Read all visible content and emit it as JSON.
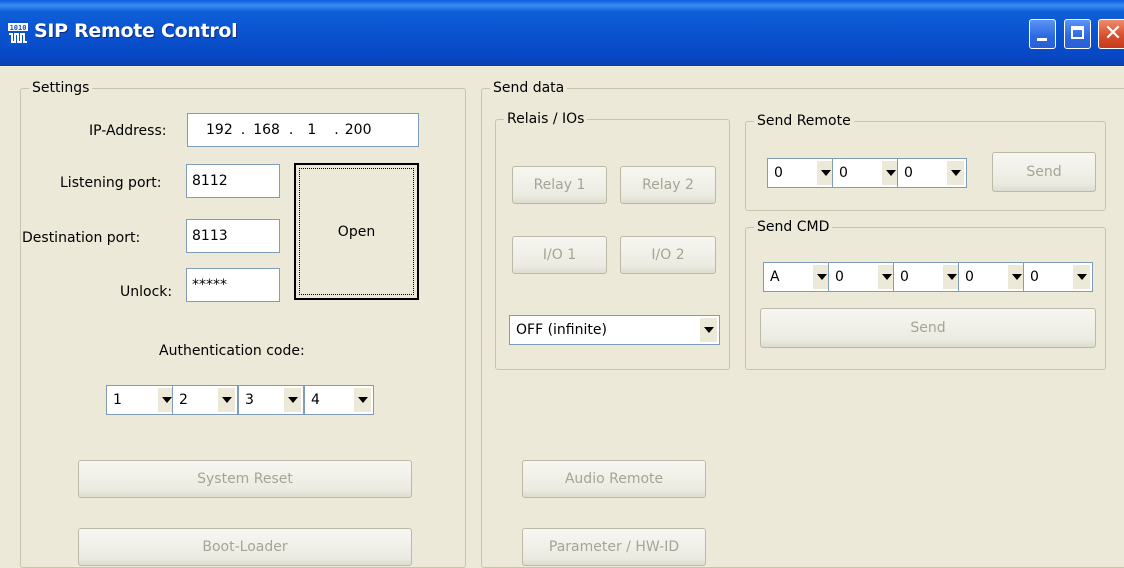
{
  "window": {
    "title": "SIP Remote Control"
  },
  "settings": {
    "group_label": "Settings",
    "ip_label": "IP-Address:",
    "ip": [
      "192",
      "168",
      "1",
      "200"
    ],
    "listen_label": "Listening port:",
    "listen_value": "8112",
    "dest_label": "Destination port:",
    "dest_value": "8113",
    "unlock_label": "Unlock:",
    "unlock_value": "*****",
    "open_label": "Open",
    "auth_label": "Authentication code:",
    "auth_codes": [
      "1",
      "2",
      "3",
      "4"
    ],
    "system_reset_label": "System Reset",
    "boot_loader_label": "Boot-Loader"
  },
  "send_data": {
    "group_label": "Send data",
    "relais": {
      "group_label": "Relais / IOs",
      "relay1_label": "Relay 1",
      "relay2_label": "Relay 2",
      "io1_label": "I/O 1",
      "io2_label": "I/O 2",
      "duration_value": "OFF (infinite)"
    },
    "remote": {
      "group_label": "Send Remote",
      "values": [
        "0",
        "0",
        "0"
      ],
      "send_label": "Send"
    },
    "cmd": {
      "group_label": "Send CMD",
      "values": [
        "A",
        "0",
        "0",
        "0",
        "0"
      ],
      "send_label": "Send"
    },
    "audio_remote_label": "Audio Remote",
    "parameter_label": "Parameter / HW-ID"
  },
  "colors": {
    "titlebar": "#0a53d0",
    "face": "#ece9d8",
    "disabled_text": "#a6a497",
    "field_border": "#7f9db9"
  },
  "icons": {
    "app": "sip-app-icon",
    "minimize": "minimize-icon",
    "maximize": "maximize-icon",
    "close": "close-icon",
    "dropdown": "chevron-down-icon"
  }
}
